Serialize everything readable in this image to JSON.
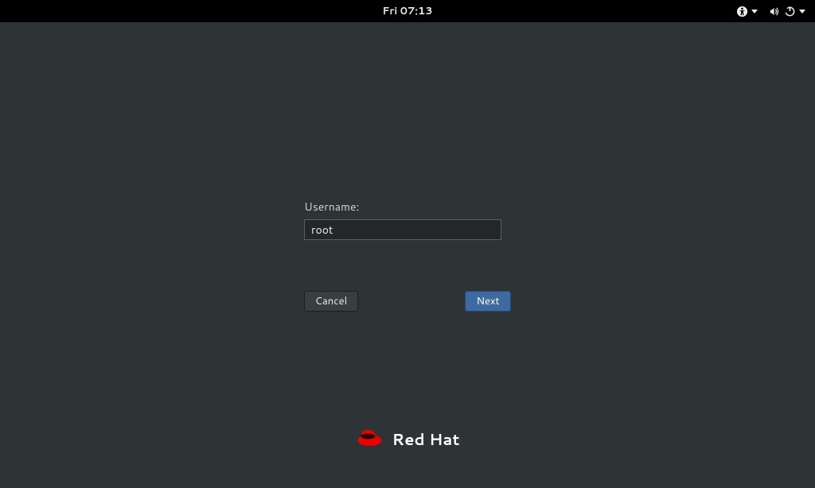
{
  "topbar": {
    "clock": "Fri 07:13"
  },
  "login": {
    "username_label": "Username:",
    "username_value": "root",
    "cancel_label": "Cancel",
    "next_label": "Next"
  },
  "branding": {
    "name": "Red Hat"
  }
}
